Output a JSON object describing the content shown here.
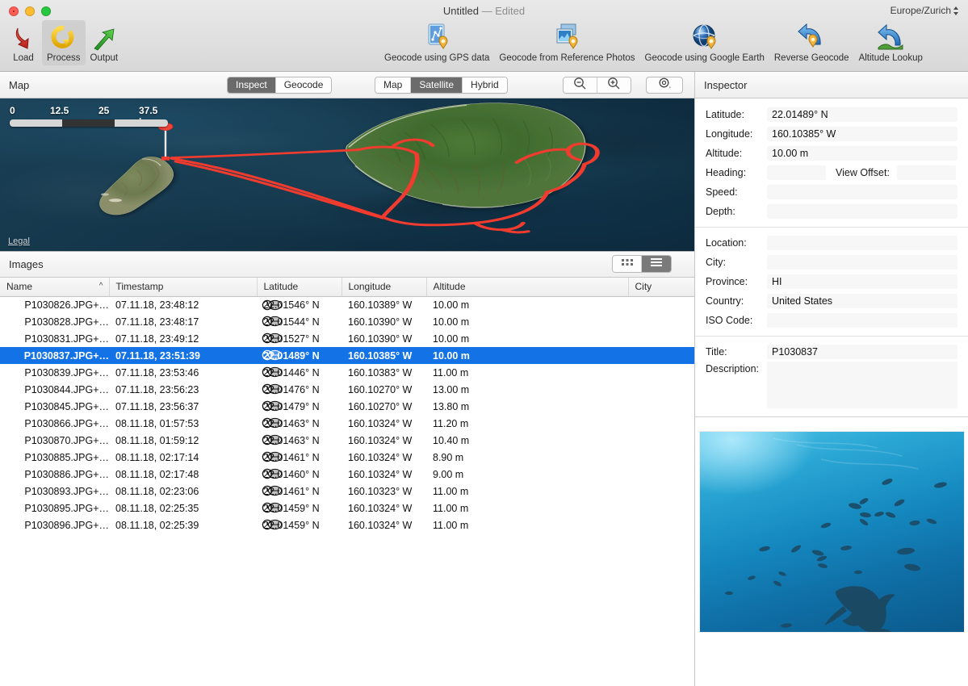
{
  "window": {
    "title": "Untitled",
    "edited_suffix": "— Edited",
    "timezone": "Europe/Zurich"
  },
  "toolbar": {
    "left_items": [
      {
        "label": "Load",
        "icon": "load-arrow-down-icon",
        "selected": false
      },
      {
        "label": "Process",
        "icon": "process-circular-arrow-icon",
        "selected": true
      },
      {
        "label": "Output",
        "icon": "output-arrow-up-icon",
        "selected": false
      }
    ],
    "right_items": [
      {
        "label": "Geocode using GPS data",
        "icon": "gps-track-document-pin-icon"
      },
      {
        "label": "Geocode from Reference Photos",
        "icon": "reference-photos-pin-icon"
      },
      {
        "label": "Geocode using Google Earth",
        "icon": "globe-pin-icon"
      },
      {
        "label": "Reverse Geocode",
        "icon": "reverse-arrow-pin-icon"
      },
      {
        "label": "Altitude Lookup",
        "icon": "altitude-arrow-terrain-icon"
      }
    ]
  },
  "map_panel": {
    "title": "Map",
    "mode_segment": {
      "options": [
        "Inspect",
        "Geocode"
      ],
      "selected": "Inspect"
    },
    "type_segment": {
      "options": [
        "Map",
        "Satellite",
        "Hybrid"
      ],
      "selected": "Satellite"
    },
    "zoom_out_icon": "zoom-out-magnifier-icon",
    "zoom_in_icon": "zoom-in-magnifier-icon",
    "gear_icon": "gear-options-icon",
    "scale": {
      "ticks": [
        "0",
        "12.5",
        "25",
        "37.5 km"
      ]
    },
    "legal_link": "Legal",
    "accent_track_color": "#f23b2f",
    "pin_color": "#f2463a"
  },
  "images_panel": {
    "title": "Images",
    "view_modes": [
      {
        "icon": "grid-view-icon",
        "active": false
      },
      {
        "icon": "list-view-icon",
        "active": true
      }
    ],
    "columns": [
      "Name",
      "Timestamp",
      "Latitude",
      "Longitude",
      "Altitude",
      "City"
    ],
    "sorted_column": "Name",
    "sort_direction": "ascending",
    "selected_row_index": 3,
    "selection_color": "#1373e6",
    "rows": [
      {
        "name": "P1030826.JPG+…",
        "timestamp": "07.11.18, 23:48:12",
        "latitude": "22.01546° N",
        "longitude": "160.10389° W",
        "altitude": "10.00 m",
        "city": ""
      },
      {
        "name": "P1030828.JPG+…",
        "timestamp": "07.11.18, 23:48:17",
        "latitude": "22.01544° N",
        "longitude": "160.10390° W",
        "altitude": "10.00 m",
        "city": ""
      },
      {
        "name": "P1030831.JPG+…",
        "timestamp": "07.11.18, 23:49:12",
        "latitude": "22.01527° N",
        "longitude": "160.10390° W",
        "altitude": "10.00 m",
        "city": ""
      },
      {
        "name": "P1030837.JPG+…",
        "timestamp": "07.11.18, 23:51:39",
        "latitude": "22.01489° N",
        "longitude": "160.10385° W",
        "altitude": "10.00 m",
        "city": ""
      },
      {
        "name": "P1030839.JPG+…",
        "timestamp": "07.11.18, 23:53:46",
        "latitude": "22.01446° N",
        "longitude": "160.10383° W",
        "altitude": "11.00 m",
        "city": ""
      },
      {
        "name": "P1030844.JPG+…",
        "timestamp": "07.11.18, 23:56:23",
        "latitude": "22.01476° N",
        "longitude": "160.10270° W",
        "altitude": "13.00 m",
        "city": ""
      },
      {
        "name": "P1030845.JPG+…",
        "timestamp": "07.11.18, 23:56:37",
        "latitude": "22.01479° N",
        "longitude": "160.10270° W",
        "altitude": "13.80 m",
        "city": ""
      },
      {
        "name": "P1030866.JPG+…",
        "timestamp": "08.11.18, 01:57:53",
        "latitude": "22.01463° N",
        "longitude": "160.10324° W",
        "altitude": "11.20 m",
        "city": ""
      },
      {
        "name": "P1030870.JPG+…",
        "timestamp": "08.11.18, 01:59:12",
        "latitude": "22.01463° N",
        "longitude": "160.10324° W",
        "altitude": "10.40 m",
        "city": ""
      },
      {
        "name": "P1030885.JPG+…",
        "timestamp": "08.11.18, 02:17:14",
        "latitude": "22.01461° N",
        "longitude": "160.10324° W",
        "altitude": "8.90 m",
        "city": ""
      },
      {
        "name": "P1030886.JPG+…",
        "timestamp": "08.11.18, 02:17:48",
        "latitude": "22.01460° N",
        "longitude": "160.10324° W",
        "altitude": "9.00 m",
        "city": ""
      },
      {
        "name": "P1030893.JPG+…",
        "timestamp": "08.11.18, 02:23:06",
        "latitude": "22.01461° N",
        "longitude": "160.10323° W",
        "altitude": "11.00 m",
        "city": ""
      },
      {
        "name": "P1030895.JPG+…",
        "timestamp": "08.11.18, 02:25:35",
        "latitude": "22.01459° N",
        "longitude": "160.10324° W",
        "altitude": "11.00 m",
        "city": ""
      },
      {
        "name": "P1030896.JPG+…",
        "timestamp": "08.11.18, 02:25:39",
        "latitude": "22.01459° N",
        "longitude": "160.10324° W",
        "altitude": "11.00 m",
        "city": ""
      }
    ]
  },
  "inspector": {
    "title": "Inspector",
    "fields": {
      "latitude_label": "Latitude:",
      "latitude_value": "22.01489° N",
      "longitude_label": "Longitude:",
      "longitude_value": "160.10385° W",
      "altitude_label": "Altitude:",
      "altitude_value": "10.00 m",
      "heading_label": "Heading:",
      "heading_value": "",
      "view_offset_label": "View Offset:",
      "view_offset_value": "",
      "speed_label": "Speed:",
      "speed_value": "",
      "depth_label": "Depth:",
      "depth_value": "",
      "location_label": "Location:",
      "location_value": "",
      "city_label": "City:",
      "city_value": "",
      "province_label": "Province:",
      "province_value": "HI",
      "country_label": "Country:",
      "country_value": "United States",
      "iso_code_label": "ISO Code:",
      "iso_code_value": "",
      "title_label": "Title:",
      "title_value": "P1030837",
      "description_label": "Description:",
      "description_value": ""
    },
    "preview": {
      "alt": "underwater-photo-shark-and-fish"
    }
  }
}
